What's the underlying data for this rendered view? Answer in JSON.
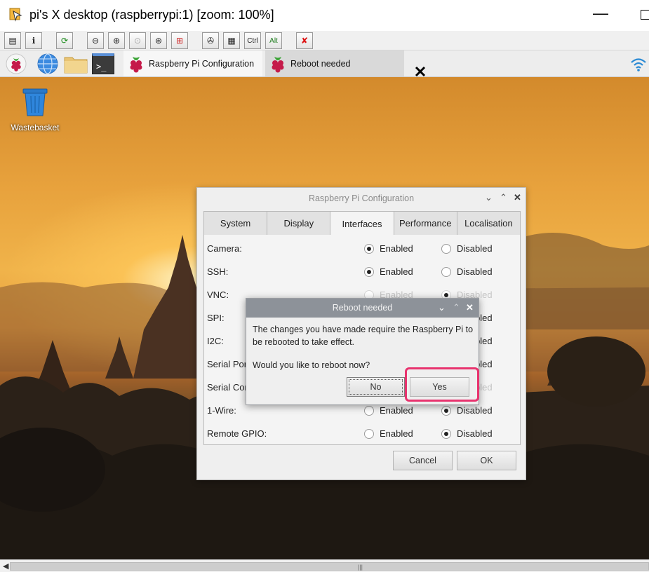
{
  "window": {
    "title": "pi's X desktop (raspberrypi:1) [zoom: 100%]",
    "minimize_glyph": "—",
    "icons": [
      "app-icon",
      "minimize-icon",
      "maximize-icon"
    ]
  },
  "vnc_toolbar": {
    "ctrl_label": "Ctrl",
    "alt_label": "Alt",
    "icons": [
      "options-icon",
      "info-icon",
      "refresh-icon",
      "zoom-out-icon",
      "zoom-in-icon",
      "zoom-reset-icon",
      "zoom-100-icon",
      "fullscreen-icon",
      "send-ctrl-alt-del-icon",
      "send-keys-icon",
      "disconnect-icon"
    ]
  },
  "taskbar": {
    "tasks": [
      {
        "label": "Raspberry Pi Configuration"
      },
      {
        "label": "Reboot needed"
      }
    ],
    "icons": [
      "raspberry-menu-icon",
      "web-browser-icon",
      "file-manager-icon",
      "terminal-icon",
      "wifi-icon"
    ],
    "terminal_glyph": ">_"
  },
  "desktop": {
    "icons": [
      {
        "label": "Wastebasket"
      }
    ]
  },
  "config_window": {
    "title": "Raspberry Pi Configuration",
    "tabs": [
      "System",
      "Display",
      "Interfaces",
      "Performance",
      "Localisation"
    ],
    "active_tab": "Interfaces",
    "enabled_label": "Enabled",
    "disabled_label": "Disabled",
    "rows": [
      {
        "name": "Camera:",
        "value": "Enabled"
      },
      {
        "name": "SSH:",
        "value": "Enabled"
      },
      {
        "name": "VNC:",
        "value": "Disabled"
      },
      {
        "name": "SPI:",
        "value": "Disabled"
      },
      {
        "name": "I2C:",
        "value": "Disabled"
      },
      {
        "name": "Serial Port:",
        "value": "Disabled"
      },
      {
        "name": "Serial Console:",
        "value": "Disabled"
      },
      {
        "name": "1-Wire:",
        "value": "Disabled"
      },
      {
        "name": "Remote GPIO:",
        "value": "Disabled"
      }
    ],
    "cancel_label": "Cancel",
    "ok_label": "OK"
  },
  "reboot_dialog": {
    "title": "Reboot needed",
    "message": "The changes you have made require the Raspberry Pi to be rebooted to take effect.",
    "question": "Would you like to reboot now?",
    "no_label": "No",
    "yes_label": "Yes"
  },
  "scrollbar": {
    "grip": "|||"
  },
  "colors": {
    "highlight": "#e8336e",
    "dialog_title_bg": "#8d9299"
  }
}
